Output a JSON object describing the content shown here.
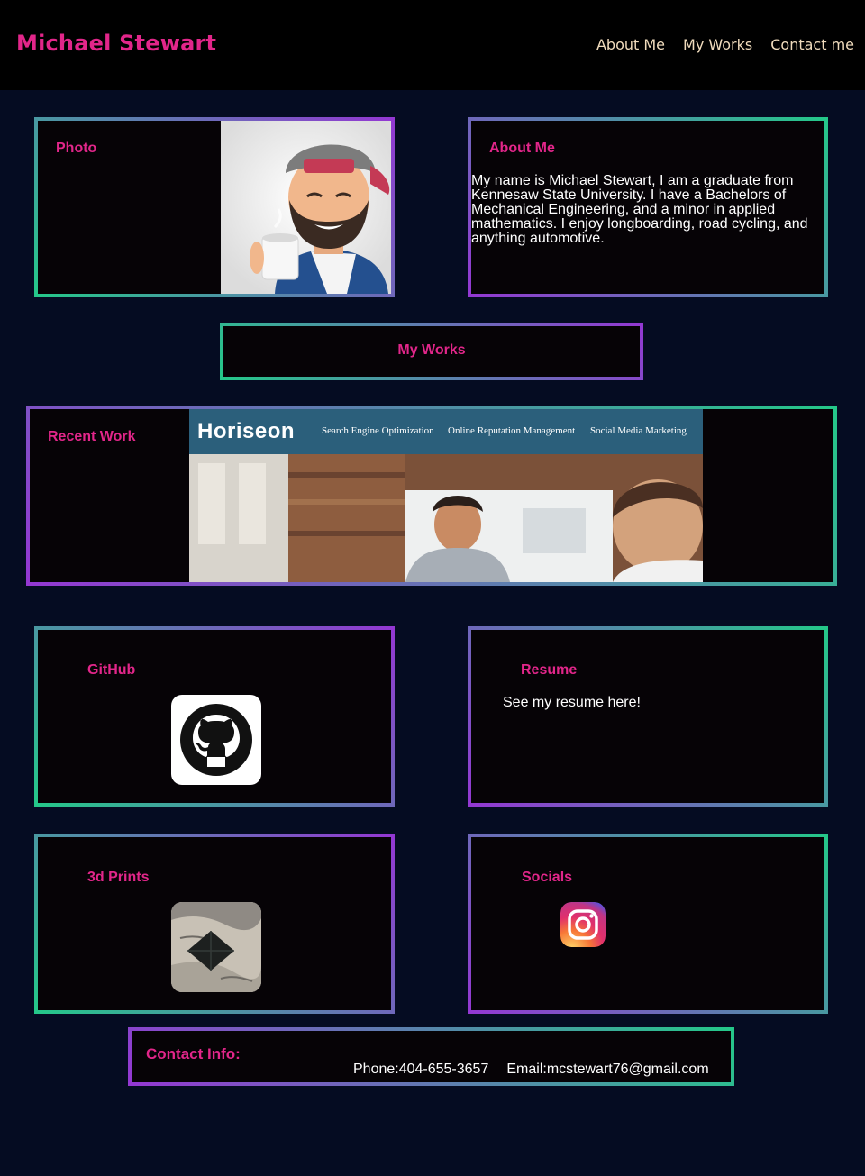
{
  "header": {
    "brand": "Michael Stewart",
    "nav": [
      "About Me",
      "My Works",
      "Contact me"
    ]
  },
  "photo": {
    "title": "Photo",
    "image": "bitmoji-avatar-with-coffee"
  },
  "about": {
    "title": "About Me",
    "text": "My name is Michael Stewart, I am a graduate from Kennesaw State University. I have a Bachelors of Mechanical Engineering, and a minor in applied mathematics. I enjoy longboarding, road cycling, and anything automotive."
  },
  "works": {
    "title": "My Works"
  },
  "recent": {
    "title": "Recent Work",
    "screenshot": {
      "logo": "Horiseon",
      "nav": [
        "Search Engine Optimization",
        "Online Reputation Management",
        "Social Media Marketing"
      ]
    }
  },
  "github": {
    "title": "GitHub",
    "icon": "github-icon"
  },
  "resume": {
    "title": "Resume",
    "text": "See my resume here!"
  },
  "prints": {
    "title": "3d Prints",
    "image": "3d-print-pyramid-photo"
  },
  "socials": {
    "title": "Socials",
    "icon": "instagram-icon"
  },
  "contact": {
    "title": "Contact Info:",
    "phone": "Phone:404-655-3657",
    "email": "Email:mcstewart76@gmail.com"
  },
  "colors": {
    "background": "#050c22",
    "header": "#000000",
    "accent_pink": "#e2268a",
    "nav_text": "#f1dcbd",
    "border_green": "#24c989",
    "border_purple": "#9437d3"
  }
}
